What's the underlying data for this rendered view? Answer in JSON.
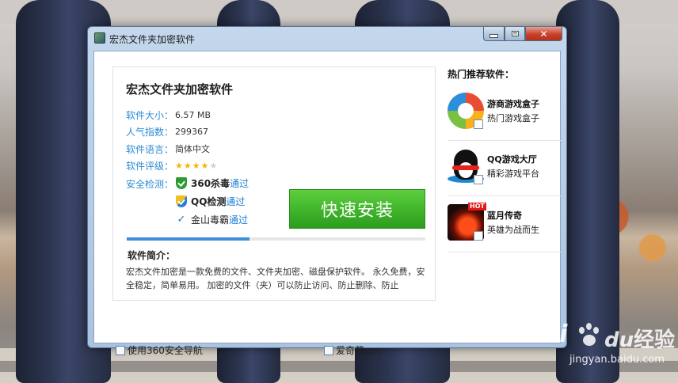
{
  "window": {
    "title": "宏杰文件夹加密软件",
    "close_glyph": "✕"
  },
  "info": {
    "app_name": "宏杰文件夹加密软件",
    "rows": [
      {
        "label": "软件大小：",
        "value": "6.57 MB"
      },
      {
        "label": "人气指数：",
        "value": "299367"
      },
      {
        "label": "软件语言：",
        "value": "简体中文"
      },
      {
        "label": "软件评级：",
        "value": ""
      },
      {
        "label": "安全检测：",
        "value": ""
      }
    ],
    "rating": {
      "value": 4,
      "max": 5
    },
    "security": [
      {
        "name": "360杀毒",
        "status": "通过",
        "icon": "shield-360-icon"
      },
      {
        "name": "QQ检测",
        "status": "通过",
        "icon": "shield-qq-icon"
      },
      {
        "name": "金山毒霸",
        "status": "通过",
        "icon": "kingsoft-icon"
      }
    ],
    "install_label": "快速安装",
    "progress": 0.41,
    "intro_heading": "软件简介：",
    "intro_text": "宏杰文件加密是一款免费的文件、文件夹加密、磁盘保护软件。 永久免费，安全稳定，简单易用。 加密的文件（夹）可以防止访问、防止删除、防止"
  },
  "hot": {
    "heading": "热门推荐软件：",
    "items": [
      {
        "name": "游商游戏盒子",
        "desc": "热门游戏盒子",
        "icon": "youshang-logo-icon"
      },
      {
        "name": "QQ游戏大厅",
        "desc": "精彩游戏平台",
        "icon": "qq-penguin-icon"
      },
      {
        "name": "蓝月传奇",
        "desc": "英雄为战而生",
        "icon": "lanyue-logo-icon",
        "badge": "HOT"
      }
    ]
  },
  "options": [
    {
      "label": "使用360安全导航"
    },
    {
      "label": "爱奇艺pps"
    }
  ],
  "watermark": {
    "brand": "Bai",
    "brand_suffix": "du",
    "cn": "经验",
    "url": "jingyan.baidu.com"
  },
  "colors": {
    "label_blue": "#2e8bd3",
    "install_green": "#3fb42a",
    "progress_blue": "#3a8fd8",
    "close_red": "#c7412b"
  }
}
